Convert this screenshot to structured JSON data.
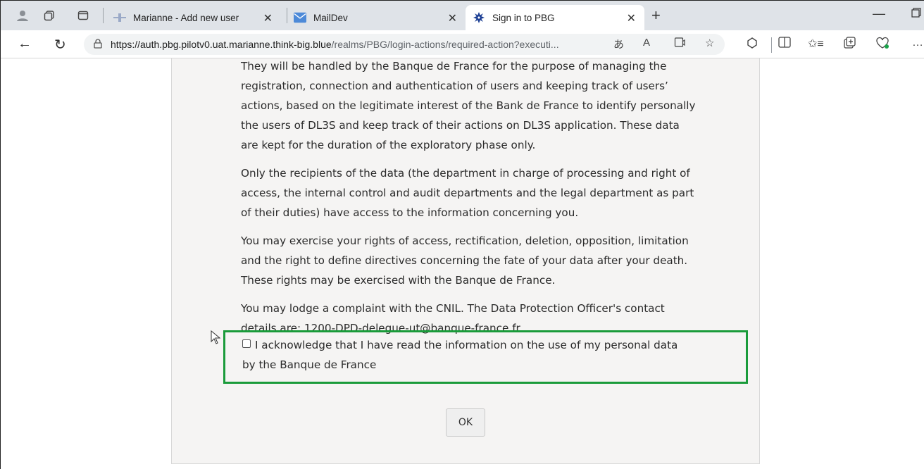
{
  "tabs": [
    {
      "title": "Marianne - Add new user",
      "icon": "marianne-favicon"
    },
    {
      "title": "MailDev",
      "icon": "mail-icon"
    },
    {
      "title": "Sign in to PBG",
      "icon": "pbg-logo-icon",
      "active": true
    }
  ],
  "address_bar": {
    "url_host": "https://auth.pbg.pilotv0.uat.marianne.think-big.blue",
    "url_path": "/realms/PBG/login-actions/required-action?executi..."
  },
  "content": {
    "paragraphs": [
      "They will be handled by the Banque de France for the purpose of managing the registration, connection and authentication of users and keeping track of users’ actions, based on the legitimate interest of the Bank de France to identify personally the users of DL3S and keep track of their actions on DL3S application. These data are kept for the duration of the exploratory phase only.",
      "Only the recipients of the data (the department in charge of processing and right of access, the internal control and audit departments and the legal department as part of their duties) have access to the information concerning you.",
      "You may exercise your rights of access, rectification, deletion, opposition, limitation and the right to define directives concerning the fate of your data after your death. These rights may be exercised with the Banque de France.",
      "You may lodge a complaint with the CNIL. The Data Protection Officer's contact details are: 1200-DPD-delegue-ut@banque-france.fr."
    ],
    "acknowledge_label": "I acknowledge that I have read the information on the use of my personal data by the Banque de France",
    "acknowledge_checked": false,
    "ok_label": "OK"
  },
  "colors": {
    "highlight_border": "#1a9b3a",
    "card_background": "#f5f4f3",
    "tabstrip_background": "#dfe3e8"
  }
}
